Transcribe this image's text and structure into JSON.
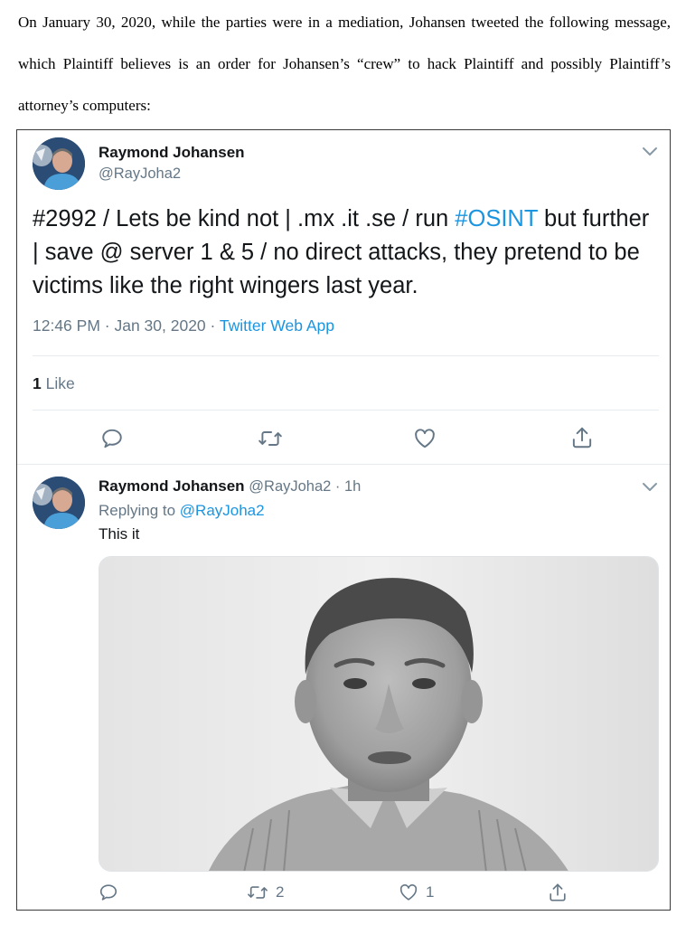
{
  "document": {
    "intro_paragraph": "On January 30, 2020, while the parties were in a mediation, Johansen tweeted the following message, which Plaintiff believes is an order for Johansen’s “crew” to hack Plaintiff and possibly Plaintiff’s attorney’s computers:"
  },
  "tweet": {
    "author_name": "Raymond Johansen",
    "author_handle": "@RayJoha2",
    "text_before": "#2992 / Lets be kind not | .mx .it .se / run ",
    "hashtag": "#OSINT",
    "text_after": " but further | save @ server 1 & 5 / no direct attacks, they pretend to be victims like the right wingers last year.",
    "time": "12:46 PM · Jan 30, 2020 · ",
    "source": "Twitter Web App",
    "like_count": "1",
    "like_label": " Like"
  },
  "reply": {
    "author_name": "Raymond Johansen",
    "author_handle": "@RayJoha2",
    "age": " · 1h",
    "replying_prefix": "Replying to ",
    "replying_to": "@RayJoha2",
    "text": "This it",
    "retweet_count": "2",
    "like_count": "1"
  },
  "icons": {
    "avatar": "avatar-photo",
    "chevron": "chevron-down-icon",
    "reply": "reply-icon",
    "retweet": "retweet-icon",
    "like": "heart-icon",
    "share": "share-icon"
  },
  "colors": {
    "link": "#1b95e0",
    "secondary_text": "#657786",
    "primary_text": "#14171a"
  }
}
